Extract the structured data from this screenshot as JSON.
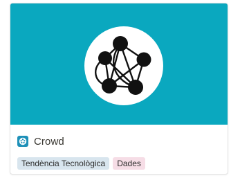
{
  "card": {
    "title": "Crowd",
    "page_icon": "crowd-icon",
    "cover_icon": "network-graph-icon",
    "tags": [
      {
        "label": "Tendència Tecnològica",
        "color": "#d8e5ee"
      },
      {
        "label": "Dades",
        "color": "#f6dde6"
      }
    ]
  },
  "colors": {
    "cover": "#0aa8bf",
    "page_icon_bg": "#1e90b8"
  }
}
